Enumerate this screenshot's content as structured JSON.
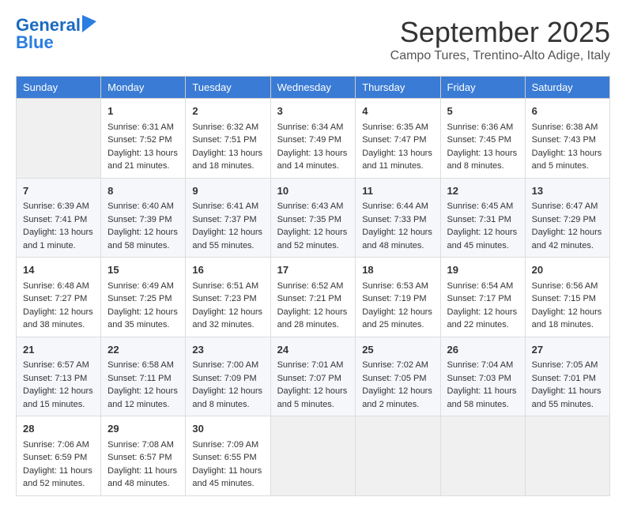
{
  "logo": {
    "line1": "General",
    "line2": "Blue"
  },
  "title": "September 2025",
  "location": "Campo Tures, Trentino-Alto Adige, Italy",
  "weekdays": [
    "Sunday",
    "Monday",
    "Tuesday",
    "Wednesday",
    "Thursday",
    "Friday",
    "Saturday"
  ],
  "weeks": [
    [
      {
        "day": "",
        "info": ""
      },
      {
        "day": "1",
        "info": "Sunrise: 6:31 AM\nSunset: 7:52 PM\nDaylight: 13 hours\nand 21 minutes."
      },
      {
        "day": "2",
        "info": "Sunrise: 6:32 AM\nSunset: 7:51 PM\nDaylight: 13 hours\nand 18 minutes."
      },
      {
        "day": "3",
        "info": "Sunrise: 6:34 AM\nSunset: 7:49 PM\nDaylight: 13 hours\nand 14 minutes."
      },
      {
        "day": "4",
        "info": "Sunrise: 6:35 AM\nSunset: 7:47 PM\nDaylight: 13 hours\nand 11 minutes."
      },
      {
        "day": "5",
        "info": "Sunrise: 6:36 AM\nSunset: 7:45 PM\nDaylight: 13 hours\nand 8 minutes."
      },
      {
        "day": "6",
        "info": "Sunrise: 6:38 AM\nSunset: 7:43 PM\nDaylight: 13 hours\nand 5 minutes."
      }
    ],
    [
      {
        "day": "7",
        "info": "Sunrise: 6:39 AM\nSunset: 7:41 PM\nDaylight: 13 hours\nand 1 minute."
      },
      {
        "day": "8",
        "info": "Sunrise: 6:40 AM\nSunset: 7:39 PM\nDaylight: 12 hours\nand 58 minutes."
      },
      {
        "day": "9",
        "info": "Sunrise: 6:41 AM\nSunset: 7:37 PM\nDaylight: 12 hours\nand 55 minutes."
      },
      {
        "day": "10",
        "info": "Sunrise: 6:43 AM\nSunset: 7:35 PM\nDaylight: 12 hours\nand 52 minutes."
      },
      {
        "day": "11",
        "info": "Sunrise: 6:44 AM\nSunset: 7:33 PM\nDaylight: 12 hours\nand 48 minutes."
      },
      {
        "day": "12",
        "info": "Sunrise: 6:45 AM\nSunset: 7:31 PM\nDaylight: 12 hours\nand 45 minutes."
      },
      {
        "day": "13",
        "info": "Sunrise: 6:47 AM\nSunset: 7:29 PM\nDaylight: 12 hours\nand 42 minutes."
      }
    ],
    [
      {
        "day": "14",
        "info": "Sunrise: 6:48 AM\nSunset: 7:27 PM\nDaylight: 12 hours\nand 38 minutes."
      },
      {
        "day": "15",
        "info": "Sunrise: 6:49 AM\nSunset: 7:25 PM\nDaylight: 12 hours\nand 35 minutes."
      },
      {
        "day": "16",
        "info": "Sunrise: 6:51 AM\nSunset: 7:23 PM\nDaylight: 12 hours\nand 32 minutes."
      },
      {
        "day": "17",
        "info": "Sunrise: 6:52 AM\nSunset: 7:21 PM\nDaylight: 12 hours\nand 28 minutes."
      },
      {
        "day": "18",
        "info": "Sunrise: 6:53 AM\nSunset: 7:19 PM\nDaylight: 12 hours\nand 25 minutes."
      },
      {
        "day": "19",
        "info": "Sunrise: 6:54 AM\nSunset: 7:17 PM\nDaylight: 12 hours\nand 22 minutes."
      },
      {
        "day": "20",
        "info": "Sunrise: 6:56 AM\nSunset: 7:15 PM\nDaylight: 12 hours\nand 18 minutes."
      }
    ],
    [
      {
        "day": "21",
        "info": "Sunrise: 6:57 AM\nSunset: 7:13 PM\nDaylight: 12 hours\nand 15 minutes."
      },
      {
        "day": "22",
        "info": "Sunrise: 6:58 AM\nSunset: 7:11 PM\nDaylight: 12 hours\nand 12 minutes."
      },
      {
        "day": "23",
        "info": "Sunrise: 7:00 AM\nSunset: 7:09 PM\nDaylight: 12 hours\nand 8 minutes."
      },
      {
        "day": "24",
        "info": "Sunrise: 7:01 AM\nSunset: 7:07 PM\nDaylight: 12 hours\nand 5 minutes."
      },
      {
        "day": "25",
        "info": "Sunrise: 7:02 AM\nSunset: 7:05 PM\nDaylight: 12 hours\nand 2 minutes."
      },
      {
        "day": "26",
        "info": "Sunrise: 7:04 AM\nSunset: 7:03 PM\nDaylight: 11 hours\nand 58 minutes."
      },
      {
        "day": "27",
        "info": "Sunrise: 7:05 AM\nSunset: 7:01 PM\nDaylight: 11 hours\nand 55 minutes."
      }
    ],
    [
      {
        "day": "28",
        "info": "Sunrise: 7:06 AM\nSunset: 6:59 PM\nDaylight: 11 hours\nand 52 minutes."
      },
      {
        "day": "29",
        "info": "Sunrise: 7:08 AM\nSunset: 6:57 PM\nDaylight: 11 hours\nand 48 minutes."
      },
      {
        "day": "30",
        "info": "Sunrise: 7:09 AM\nSunset: 6:55 PM\nDaylight: 11 hours\nand 45 minutes."
      },
      {
        "day": "",
        "info": ""
      },
      {
        "day": "",
        "info": ""
      },
      {
        "day": "",
        "info": ""
      },
      {
        "day": "",
        "info": ""
      }
    ]
  ]
}
